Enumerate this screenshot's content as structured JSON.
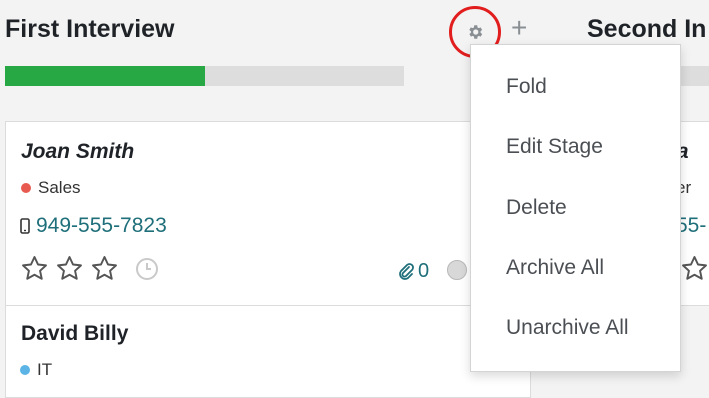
{
  "stages": {
    "first": {
      "title": "First Interview",
      "progress_fraction": 0.5
    },
    "second": {
      "title": "Second In"
    }
  },
  "icons": {
    "settings": "gear-icon",
    "add": "plus-icon",
    "phone": "mobile-phone-icon",
    "star": "star-icon",
    "clock": "clock-icon",
    "attachment": "paperclip-icon"
  },
  "colors": {
    "progress": "#28a745",
    "tag_sales": "#e85a4f",
    "tag_it": "#5bb4e5",
    "link": "#1f6f7a",
    "highlight_ring": "#e21d1d"
  },
  "cards": [
    {
      "name": "Joan Smith",
      "tag": "Sales",
      "phone": "949-555-7823",
      "stars": 0,
      "attachments": "0"
    },
    {
      "name": "David Billy",
      "tag": "IT"
    }
  ],
  "right_card": {
    "name": "I Ba",
    "tag": "er",
    "phone": "55-"
  },
  "menu": {
    "items": [
      "Fold",
      "Edit Stage",
      "Delete",
      "Archive All",
      "Unarchive All"
    ]
  }
}
